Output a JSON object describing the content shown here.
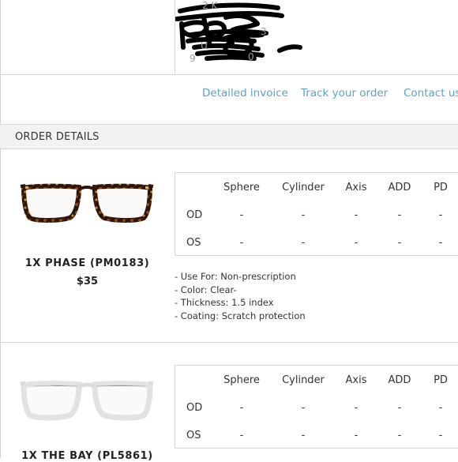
{
  "address": {
    "redacted": true
  },
  "links": [
    {
      "label": "Detailed invoice"
    },
    {
      "label": "Track your order"
    },
    {
      "label": "Contact us"
    }
  ],
  "section": {
    "title": "ORDER DETAILS"
  },
  "rx_headers": [
    "Sphere",
    "Cylinder",
    "Axis",
    "ADD",
    "PD"
  ],
  "items": [
    {
      "name": "1X PHASE (PM0183)",
      "price": "$35",
      "frame_color": "tortoise",
      "rx": [
        {
          "eye": "OD",
          "values": [
            "-",
            "-",
            "-",
            "-",
            "-"
          ]
        },
        {
          "eye": "OS",
          "values": [
            "-",
            "-",
            "-",
            "-",
            "-"
          ]
        }
      ],
      "details": [
        "- Use For: Non-prescription",
        "- Color: Clear-",
        "- Thickness: 1.5 index",
        "- Coating: Scratch protection"
      ]
    },
    {
      "name": "1X THE BAY (PL5861)",
      "frame_color": "clear",
      "rx": [
        {
          "eye": "OD",
          "values": [
            "-",
            "-",
            "-",
            "-",
            "-"
          ]
        },
        {
          "eye": "OS",
          "values": [
            "-",
            "-",
            "-",
            "-",
            "-"
          ]
        }
      ]
    }
  ]
}
